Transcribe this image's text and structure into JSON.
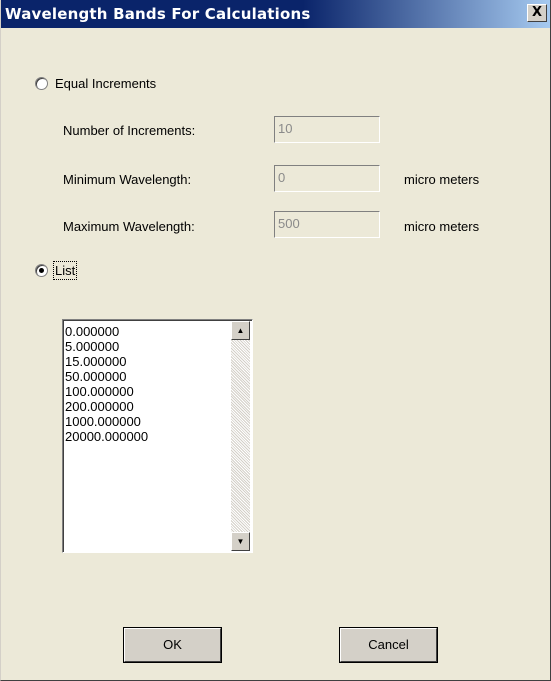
{
  "dialog": {
    "title": "Wavelength Bands For Calculations",
    "close_label": "X"
  },
  "equal_increments": {
    "label": "Equal Increments",
    "selected": false,
    "fields": [
      {
        "label": "Number of Increments:",
        "value": "10",
        "unit": ""
      },
      {
        "label": "Minimum Wavelength:",
        "value": "0",
        "unit": "micro meters"
      },
      {
        "label": "Maximum Wavelength:",
        "value": "500",
        "unit": "micro meters"
      }
    ]
  },
  "list_option": {
    "label": "List",
    "selected": true,
    "items": [
      "0.000000",
      "5.000000",
      "15.000000",
      "50.000000",
      "100.000000",
      "200.000000",
      "1000.000000",
      "20000.000000"
    ]
  },
  "buttons": {
    "ok": "OK",
    "cancel": "Cancel"
  },
  "icons": {
    "scroll_up": "triangle-up",
    "scroll_down": "triangle-down"
  }
}
